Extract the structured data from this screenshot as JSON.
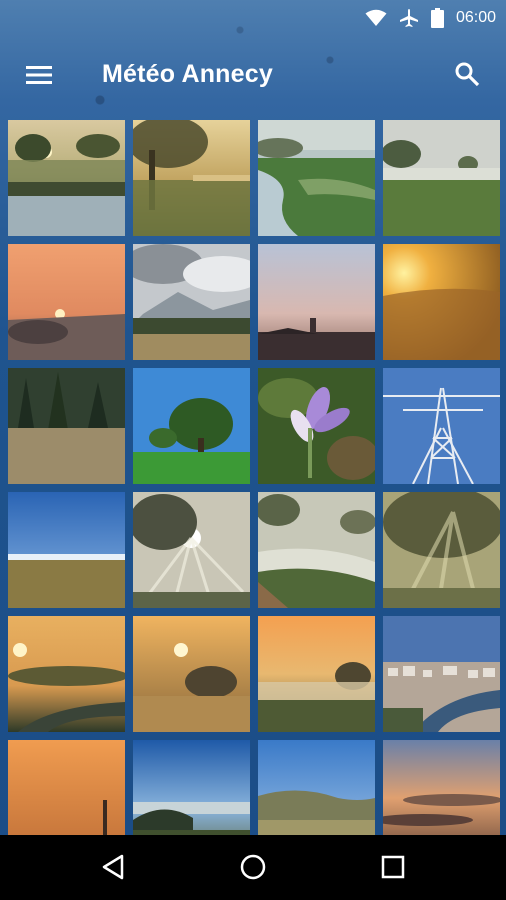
{
  "status_bar": {
    "time": "06:00",
    "icons": [
      "wifi-icon",
      "airplane-icon",
      "battery-icon"
    ]
  },
  "toolbar": {
    "title": "Météo Annecy",
    "menu_icon": "hamburger-menu-icon",
    "search_icon": "search-icon"
  },
  "photos": [
    {
      "name": "misty-river-sunrise-trees"
    },
    {
      "name": "sunlit-tree-meadow"
    },
    {
      "name": "foggy-stream-field"
    },
    {
      "name": "misty-field-treeline"
    },
    {
      "name": "orange-sunset-valley"
    },
    {
      "name": "cloudy-mountain-meadow"
    },
    {
      "name": "dusk-over-lake-town"
    },
    {
      "name": "golden-hazy-sunrise"
    },
    {
      "name": "pine-forest-meadow"
    },
    {
      "name": "green-tree-blue-sky"
    },
    {
      "name": "purple-crocus-flower"
    },
    {
      "name": "power-pylon-sky"
    },
    {
      "name": "blue-sky-field"
    },
    {
      "name": "sunbeams-through-tree"
    },
    {
      "name": "misty-river-bench"
    },
    {
      "name": "sunrays-in-fog"
    },
    {
      "name": "sunrise-over-foggy-road"
    },
    {
      "name": "sunrise-foggy-trees"
    },
    {
      "name": "orange-dawn-fog-field"
    },
    {
      "name": "city-river-aerial"
    },
    {
      "name": "orange-sky-chimney"
    },
    {
      "name": "blue-sky-fog-hills"
    },
    {
      "name": "blue-sky-hill-field"
    },
    {
      "name": "orange-cloudy-dusk"
    }
  ],
  "nav_bar": {
    "buttons": [
      "back-icon",
      "home-icon",
      "recent-apps-icon"
    ]
  },
  "colors": {
    "background": "#1d4f8a",
    "nav_bar": "#000000",
    "text": "#ffffff"
  }
}
